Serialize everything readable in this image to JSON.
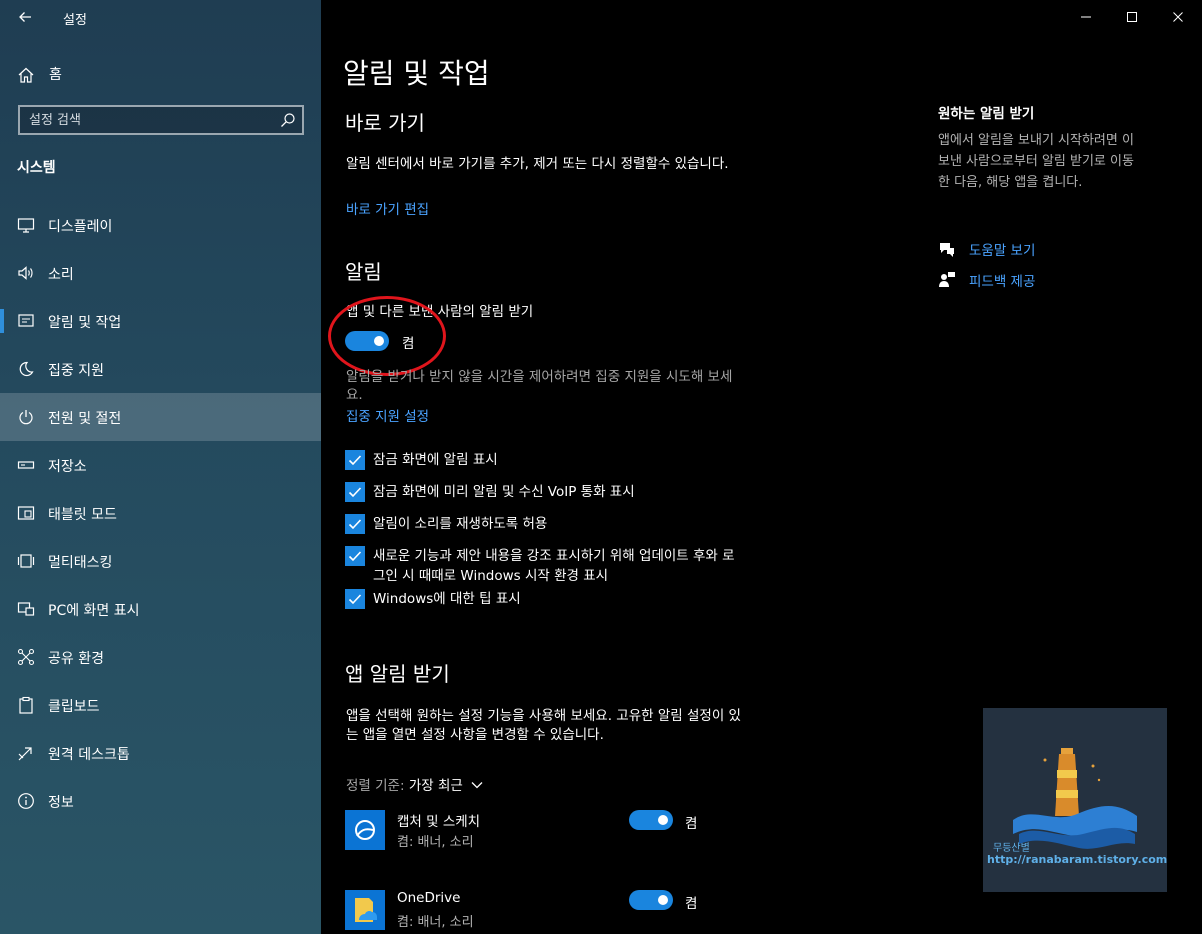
{
  "window": {
    "app_title": "설정"
  },
  "sidebar": {
    "home_label": "홈",
    "search_placeholder": "설정 검색",
    "section_header": "시스템",
    "items": [
      {
        "label": "디스플레이",
        "icon": "display-icon"
      },
      {
        "label": "소리",
        "icon": "speaker-icon"
      },
      {
        "label": "알림 및 작업",
        "icon": "notification-icon",
        "selected": true
      },
      {
        "label": "집중 지원",
        "icon": "moon-icon"
      },
      {
        "label": "전원 및 절전",
        "icon": "power-icon",
        "hover": true
      },
      {
        "label": "저장소",
        "icon": "storage-icon"
      },
      {
        "label": "태블릿 모드",
        "icon": "tablet-icon"
      },
      {
        "label": "멀티태스킹",
        "icon": "multitasking-icon"
      },
      {
        "label": "PC에 화면 표시",
        "icon": "project-icon"
      },
      {
        "label": "공유 환경",
        "icon": "share-icon"
      },
      {
        "label": "클립보드",
        "icon": "clipboard-icon"
      },
      {
        "label": "원격 데스크톱",
        "icon": "remote-desktop-icon"
      },
      {
        "label": "정보",
        "icon": "info-icon"
      }
    ]
  },
  "main": {
    "page_title": "알림 및 작업",
    "quick_actions": {
      "heading": "바로 가기",
      "description": "알림 센터에서 바로 가기를 추가, 제거 또는 다시 정렬할수 있습니다.",
      "edit_link": "바로 가기 편집"
    },
    "notifications": {
      "heading": "알림",
      "toggle_title": "앱 및 다른 보낸 사람의 알림 받기",
      "toggle_state": "켬",
      "focus_hint_1": "알림을 받거나 받지 않을 시간을 제어하려면 집중 지원을 시도해 보세",
      "focus_hint_2": "요.",
      "focus_link": "집중 지원 설정",
      "checks": [
        {
          "label": "잠금 화면에 알림 표시",
          "checked": true
        },
        {
          "label": "잠금 화면에 미리 알림 및 수신 VoIP 통화 표시",
          "checked": true
        },
        {
          "label": "알림이 소리를 재생하도록 허용",
          "checked": true
        },
        {
          "label": "새로운 기능과 제안 내용을 강조 표시하기 위해 업데이트 후와 로",
          "label2": "그인 시 때때로 Windows 시작 환경 표시",
          "checked": true
        },
        {
          "label": "Windows에 대한 팁 표시",
          "checked": true
        }
      ]
    },
    "app_notifications": {
      "heading": "앱 알림 받기",
      "description_1": "앱을 선택해 원하는 설정 기능을 사용해 보세요. 고유한 알림 설정이 있",
      "description_2": "는 앱을 열면 설정 사항을 변경할 수 있습니다.",
      "sort_label": "정렬 기준:",
      "sort_value": "가장 최근",
      "apps": [
        {
          "name": "캡처 및 스케치",
          "sub": "켬: 배너, 소리",
          "state": "켬",
          "icon": "snip-sketch-icon"
        },
        {
          "name": "OneDrive",
          "sub": "켬: 배너, 소리",
          "state": "켬",
          "icon": "onedrive-icon"
        }
      ]
    },
    "side_panel": {
      "title": "원하는 알림 받기",
      "desc_1": "앱에서 알림을 보내기 시작하려면 이",
      "desc_2": "보낸 사람으로부터 알림 받기로 이동",
      "desc_3": "한 다음, 해당 앱을 켭니다.",
      "help_link": "도움말 보기",
      "feedback_link": "피드백 제공"
    },
    "watermark": {
      "name": "무등산별",
      "url": "http://ranabaram.tistory.com"
    }
  },
  "colors": {
    "accent": "#1a85de",
    "link": "#4aa3ff",
    "annotation": "#e0151c"
  }
}
